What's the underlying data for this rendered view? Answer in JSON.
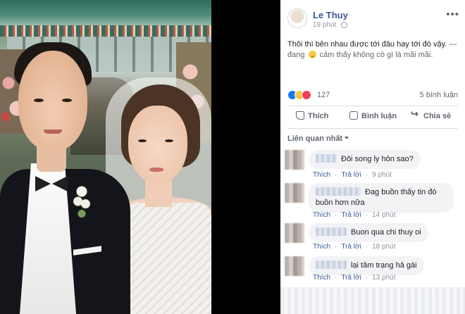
{
  "post": {
    "author": "Le Thuy",
    "time": "19 phút",
    "text": "Thôi thì bên nhau được tới đâu hay tới đó vậy.",
    "feeling_prefix": "— đang",
    "feeling_text": "cảm thấy không có gì là mãi mãi.",
    "reaction_count": "127",
    "comment_count": "5 bình luận"
  },
  "actions": {
    "like": "Thích",
    "comment": "Bình luận",
    "share": "Chia sẻ"
  },
  "sort_label": "Liên quan nhất",
  "comments": [
    {
      "text": "Đôi song ly hôn sao?",
      "like": "Thích",
      "reply": "Trả lời",
      "time": "9 phút"
    },
    {
      "text": "Đag buồn thấy tin đó buồn hơn nữa",
      "like": "Thích",
      "reply": "Trả lời",
      "time": "14 phút"
    },
    {
      "text": "Buon qua chi thuy oi",
      "like": "Thích",
      "reply": "Trả lời",
      "time": "18 phút"
    },
    {
      "text": "lại tâm trạng hả gái",
      "like": "Thích",
      "reply": "Trả lời",
      "time": "13 phút"
    }
  ],
  "colors": {
    "link": "#385898",
    "like_blue": "#1877f2",
    "love_red": "#f33e58",
    "sad_yellow": "#f7c948",
    "bubble_bg": "#f2f3f5"
  },
  "icons": [
    "globe-icon",
    "more-icon",
    "like-icon",
    "comment-icon",
    "share-icon",
    "caret-down-icon"
  ]
}
